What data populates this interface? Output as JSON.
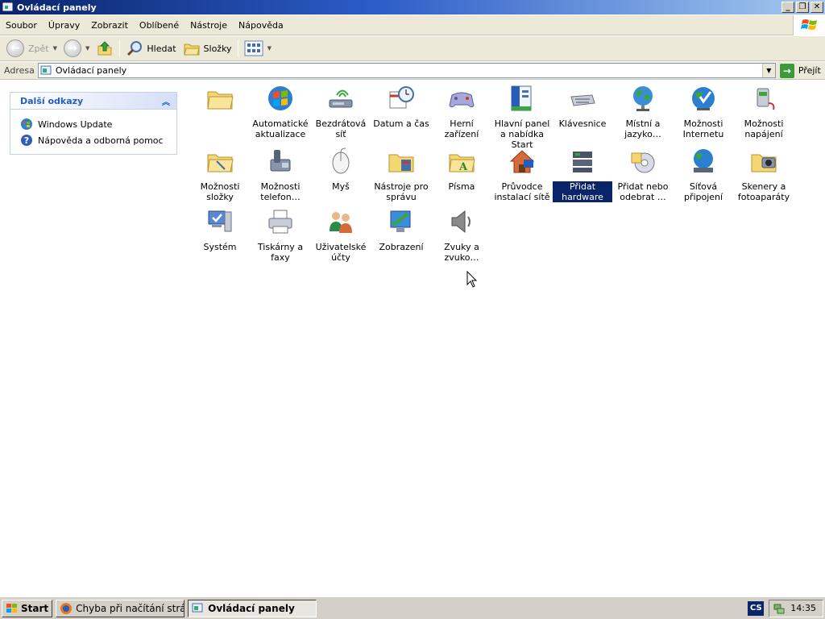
{
  "window": {
    "title": "Ovládací panely",
    "buttons": {
      "minimize": "_",
      "maximize": "❐",
      "close": "✕"
    }
  },
  "menu": [
    "Soubor",
    "Úpravy",
    "Zobrazit",
    "Oblíbené",
    "Nástroje",
    "Nápověda"
  ],
  "toolbar": {
    "back_label": "Zpět",
    "search_label": "Hledat",
    "folders_label": "Složky"
  },
  "address": {
    "label": "Adresa",
    "value": "Ovládací panely",
    "go_label": "Přejít"
  },
  "side_panel": {
    "title": "Další odkazy",
    "links": [
      "Windows Update",
      "Nápověda a odborná pomoc"
    ]
  },
  "items": [
    {
      "label": "",
      "icon": "folder-icon"
    },
    {
      "label": "Automatické aktualizace",
      "icon": "windows-update-icon"
    },
    {
      "label": "Bezdrátová síť",
      "icon": "wireless-icon"
    },
    {
      "label": "Datum a čas",
      "icon": "clock-icon"
    },
    {
      "label": "Herní zařízení",
      "icon": "gamepad-icon"
    },
    {
      "label": "Hlavní panel a nabídka Start",
      "icon": "taskbar-icon"
    },
    {
      "label": "Klávesnice",
      "icon": "keyboard-icon"
    },
    {
      "label": "Místní a jazyko…",
      "icon": "globe-icon"
    },
    {
      "label": "Možnosti Internetu",
      "icon": "internet-icon"
    },
    {
      "label": "Možnosti napájení",
      "icon": "power-icon"
    },
    {
      "label": "Možnosti složky",
      "icon": "folder-options-icon"
    },
    {
      "label": "Možnosti telefon…",
      "icon": "phone-icon"
    },
    {
      "label": "Myš",
      "icon": "mouse-icon"
    },
    {
      "label": "Nástroje pro správu",
      "icon": "admin-tools-icon"
    },
    {
      "label": "Písma",
      "icon": "fonts-icon"
    },
    {
      "label": "Průvodce instalací sítě",
      "icon": "network-wizard-icon"
    },
    {
      "label": "Přidat hardware",
      "icon": "add-hardware-icon",
      "selected": true
    },
    {
      "label": "Přidat nebo odebrat …",
      "icon": "add-remove-icon"
    },
    {
      "label": "Síťová připojení",
      "icon": "network-icon"
    },
    {
      "label": "Skenery a fotoaparáty",
      "icon": "scanner-icon"
    },
    {
      "label": "Systém",
      "icon": "system-icon"
    },
    {
      "label": "Tiskárny a faxy",
      "icon": "printer-icon"
    },
    {
      "label": "Uživatelské účty",
      "icon": "users-icon"
    },
    {
      "label": "Zobrazení",
      "icon": "display-icon"
    },
    {
      "label": "Zvuky a zvuko…",
      "icon": "speaker-icon"
    }
  ],
  "taskbar": {
    "start_label": "Start",
    "tasks": [
      {
        "label": "Chyba při načítání stránk…",
        "active": false
      },
      {
        "label": "Ovládací panely",
        "active": true
      }
    ],
    "language": "CS",
    "clock": "14:35"
  },
  "colors": {
    "title_bar": "#0a246a",
    "selection": "#0a246a",
    "link_header": "#215dc6"
  }
}
